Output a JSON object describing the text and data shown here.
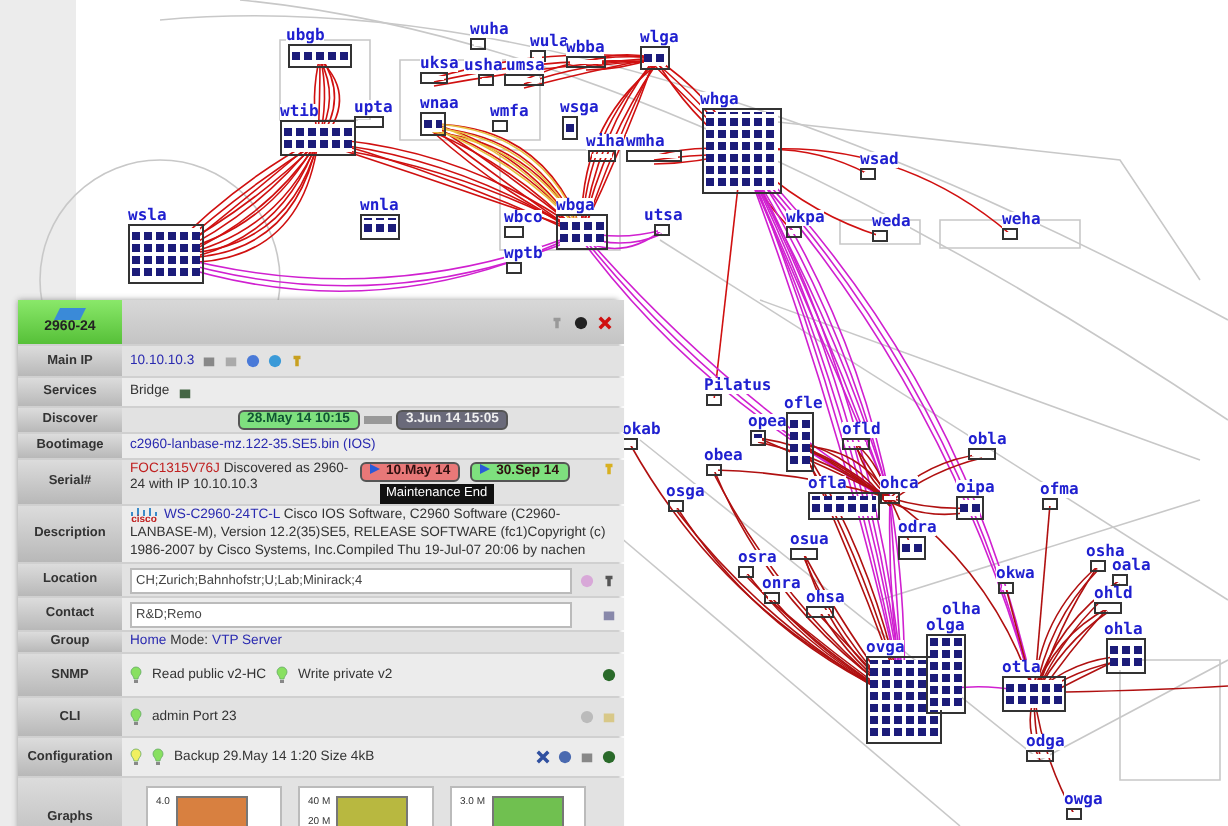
{
  "map": {
    "nodes": [
      {
        "label": "ubgb"
      },
      {
        "label": "wtib"
      },
      {
        "label": "upta"
      },
      {
        "label": "wuha"
      },
      {
        "label": "wula"
      },
      {
        "label": "wbba"
      },
      {
        "label": "wlga"
      },
      {
        "label": "uksa"
      },
      {
        "label": "usha"
      },
      {
        "label": "umsa"
      },
      {
        "label": "wnaa"
      },
      {
        "label": "wmfa"
      },
      {
        "label": "wsga"
      },
      {
        "label": "wiha"
      },
      {
        "label": "wmha"
      },
      {
        "label": "wnla"
      },
      {
        "label": "wsla"
      },
      {
        "label": "wbco"
      },
      {
        "label": "wbga"
      },
      {
        "label": "wptb"
      },
      {
        "label": "utsa"
      },
      {
        "label": "whga"
      },
      {
        "label": "wsad"
      },
      {
        "label": "wkpa"
      },
      {
        "label": "weda"
      },
      {
        "label": "weha"
      },
      {
        "label": "Pilatus"
      },
      {
        "label": "okab"
      },
      {
        "label": "ofle"
      },
      {
        "label": "opea"
      },
      {
        "label": "ofld"
      },
      {
        "label": "obea"
      },
      {
        "label": "osga"
      },
      {
        "label": "ofla"
      },
      {
        "label": "ohca"
      },
      {
        "label": "obla"
      },
      {
        "label": "oipa"
      },
      {
        "label": "ofma"
      },
      {
        "label": "odra"
      },
      {
        "label": "osua"
      },
      {
        "label": "osra"
      },
      {
        "label": "onra"
      },
      {
        "label": "ohsa"
      },
      {
        "label": "okwa"
      },
      {
        "label": "osha"
      },
      {
        "label": "oala"
      },
      {
        "label": "ohld"
      },
      {
        "label": "ohla"
      },
      {
        "label": "ovga"
      },
      {
        "label": "olga"
      },
      {
        "label": "olha"
      },
      {
        "label": "otla"
      },
      {
        "label": "odga"
      },
      {
        "label": "owga"
      }
    ]
  },
  "device_panel": {
    "title": "2960-24",
    "tooltip": "Maintenance End",
    "rows": [
      {
        "label": "Main IP",
        "kind": "link",
        "value": "10.10.10.3"
      },
      {
        "label": "Services",
        "kind": "text",
        "value": "Bridge"
      },
      {
        "label": "Discover",
        "kind": "dates",
        "first": "28.May 14 10:15",
        "last": "3.Jun 14 15:05"
      },
      {
        "label": "Bootimage",
        "kind": "link",
        "value": "c2960-lanbase-mz.122-35.SE5.bin (IOS)"
      },
      {
        "label": "Serial#",
        "kind": "serial",
        "serial": "FOC1315V76J",
        "note": "Discovered as 2960-24 with IP 10.10.10.3",
        "badges": [
          {
            "text": "10.May 14",
            "color": "#e87878"
          },
          {
            "text": "30.Sep 14",
            "color": "#7ee07e"
          }
        ]
      },
      {
        "label": "Description",
        "kind": "description",
        "logo_text": "cisco",
        "model": "WS-C2960-24TC-L",
        "value": "Cisco IOS Software, C2960 Software (C2960-LANBASE-M), Version 12.2(35)SE5, RELEASE SOFTWARE (fc1)Copyright (c) 1986-2007 by Cisco Systems, Inc.Compiled Thu 19-Jul-07 20:06 by nachen"
      },
      {
        "label": "Location",
        "kind": "field",
        "value": "CH;Zurich;Bahnhofstr;U;Lab;Minirack;4"
      },
      {
        "label": "Contact",
        "kind": "field",
        "value": "R&D;Remo"
      },
      {
        "label": "Group",
        "kind": "group",
        "group": "Home",
        "mode_label": "Mode:",
        "mode": "VTP Server"
      },
      {
        "label": "SNMP",
        "kind": "status",
        "items": [
          {
            "text": "Read public v2-HC",
            "color": "#88e060"
          },
          {
            "text": "Write private v2",
            "color": "#88e060"
          }
        ]
      },
      {
        "label": "CLI",
        "kind": "status",
        "items": [
          {
            "text": "admin Port 23",
            "color": "#88e060"
          }
        ]
      },
      {
        "label": "Configuration",
        "kind": "status",
        "items": [
          {
            "color": "#f0f060"
          },
          {
            "text": "Backup 29.May 14 1:20 Size 4kB",
            "color": "#88e060"
          }
        ]
      },
      {
        "label": "Graphs",
        "kind": "graphs",
        "graphs": [
          {
            "ticks": [
              "4.0"
            ],
            "color": "#d88040"
          },
          {
            "ticks": [
              "40 M",
              "20 M"
            ],
            "color": "#b8b840"
          },
          {
            "ticks": [
              "3.0 M"
            ],
            "color": "#70c050"
          }
        ]
      }
    ]
  }
}
